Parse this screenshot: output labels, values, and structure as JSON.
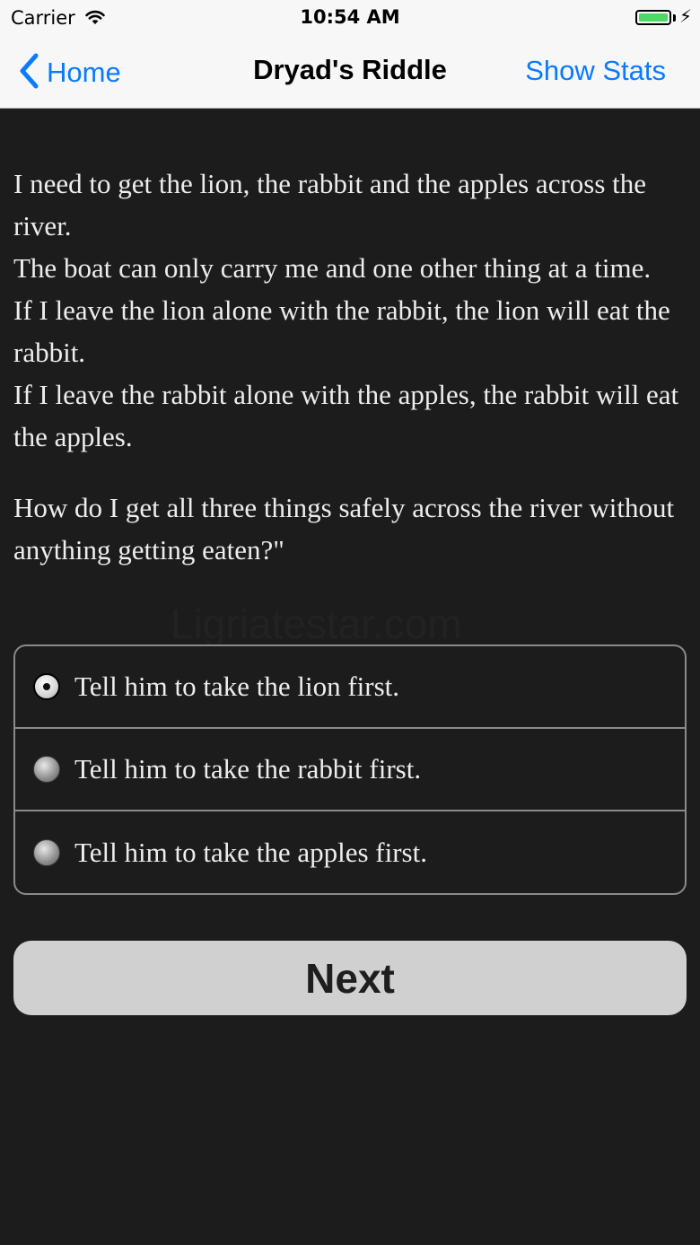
{
  "status_bar": {
    "carrier": "Carrier",
    "time": "10:54 AM",
    "battery_level": 1.0
  },
  "nav": {
    "back_label": "Home",
    "title": "Dryad's Riddle",
    "right_label": "Show Stats"
  },
  "riddle": {
    "lines": [
      "I need to get the lion, the rabbit and the apples across the river.",
      "The boat can only carry me and one other thing at a time.",
      "If I leave the lion alone with the rabbit, the lion will eat the rabbit.",
      "If I leave the rabbit alone with the apples, the rabbit will eat the apples."
    ],
    "question": "How do I get all three things safely across the river without anything getting eaten?\""
  },
  "watermark": "Ligriatestar.com",
  "options": [
    {
      "label": "Tell him to take the lion first.",
      "selected": true
    },
    {
      "label": "Tell him to take the rabbit first.",
      "selected": false
    },
    {
      "label": "Tell him to take the apples first.",
      "selected": false
    }
  ],
  "next_button": {
    "label": "Next"
  },
  "colors": {
    "accent": "#0a7aff",
    "background": "#1c1c1c",
    "text": "#ededed",
    "button_bg": "#d0d0d0",
    "battery": "#4cd964"
  }
}
